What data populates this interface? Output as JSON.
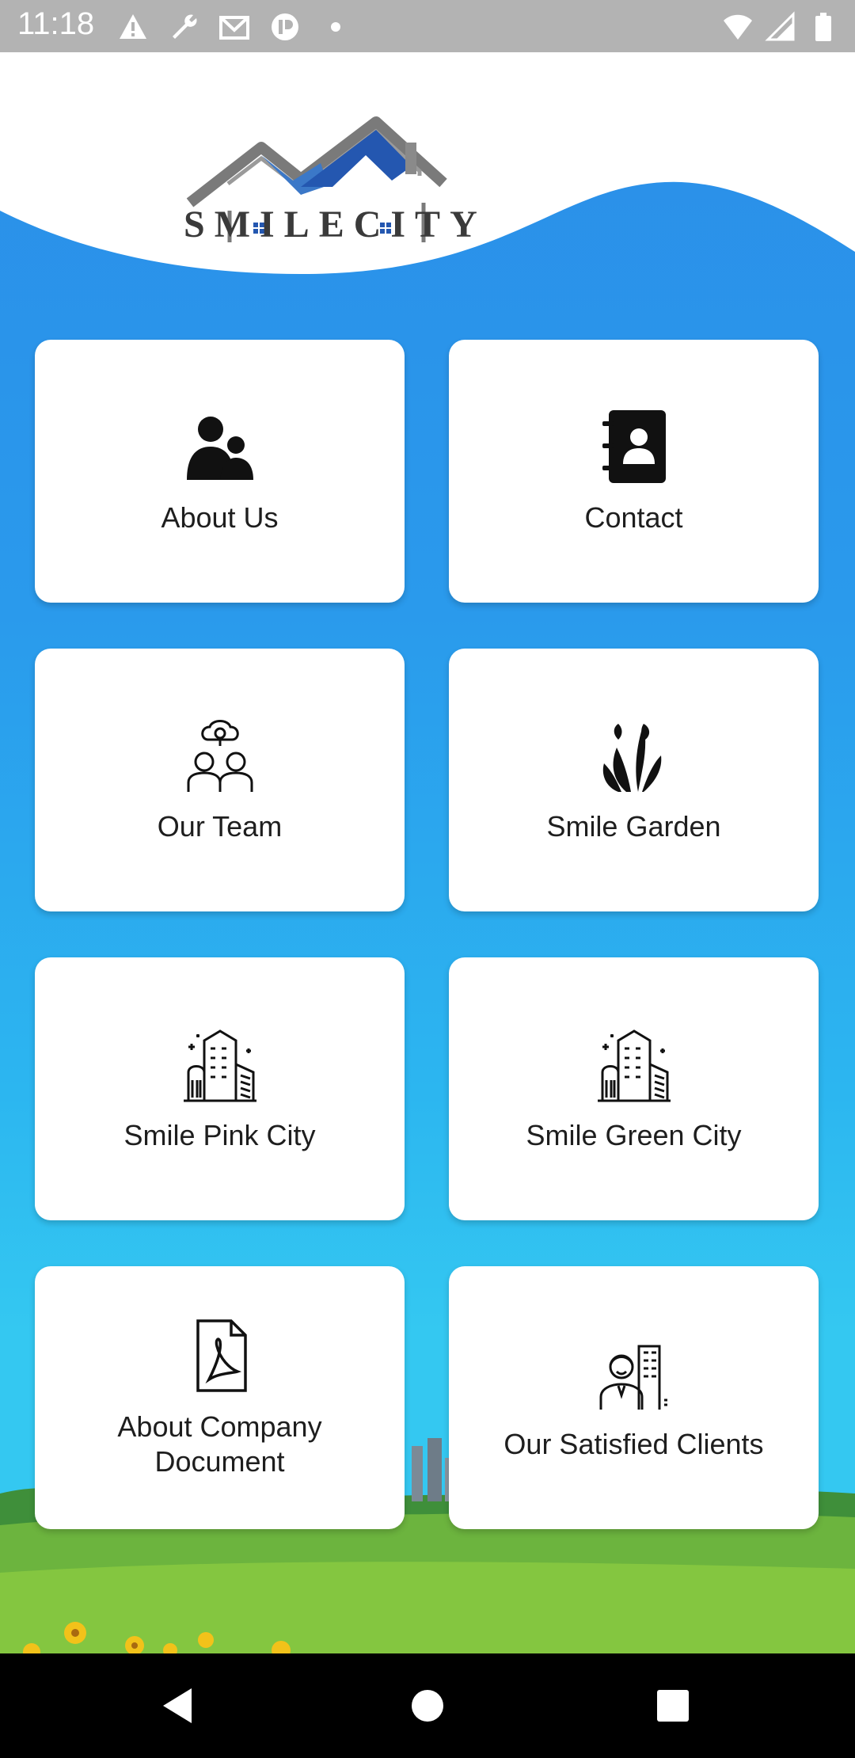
{
  "status_bar": {
    "time": "11:18",
    "left_icons": [
      "warning-icon",
      "wrench-icon",
      "gmail-icon",
      "app-icon",
      "dot-icon"
    ],
    "right_icons": [
      "wifi-icon",
      "signal-icon",
      "battery-icon"
    ]
  },
  "header": {
    "logo_text": "SMILECITY",
    "accent_color": "#2a8ee8"
  },
  "grid": {
    "items": [
      {
        "label": "About Us",
        "icon": "person-group-icon"
      },
      {
        "label": "Contact",
        "icon": "address-book-icon"
      },
      {
        "label": "Our Team",
        "icon": "team-idea-icon"
      },
      {
        "label": "Smile Garden",
        "icon": "flower-plant-icon"
      },
      {
        "label": "Smile Pink City",
        "icon": "city-buildings-icon"
      },
      {
        "label": "Smile Green City",
        "icon": "city-buildings-icon"
      },
      {
        "label": "About Company Document",
        "icon": "pdf-document-icon"
      },
      {
        "label": "Our Satisfied Clients",
        "icon": "client-building-icon"
      }
    ]
  },
  "nav_bar": {
    "icons": [
      "back-icon",
      "home-icon",
      "recents-icon"
    ]
  }
}
